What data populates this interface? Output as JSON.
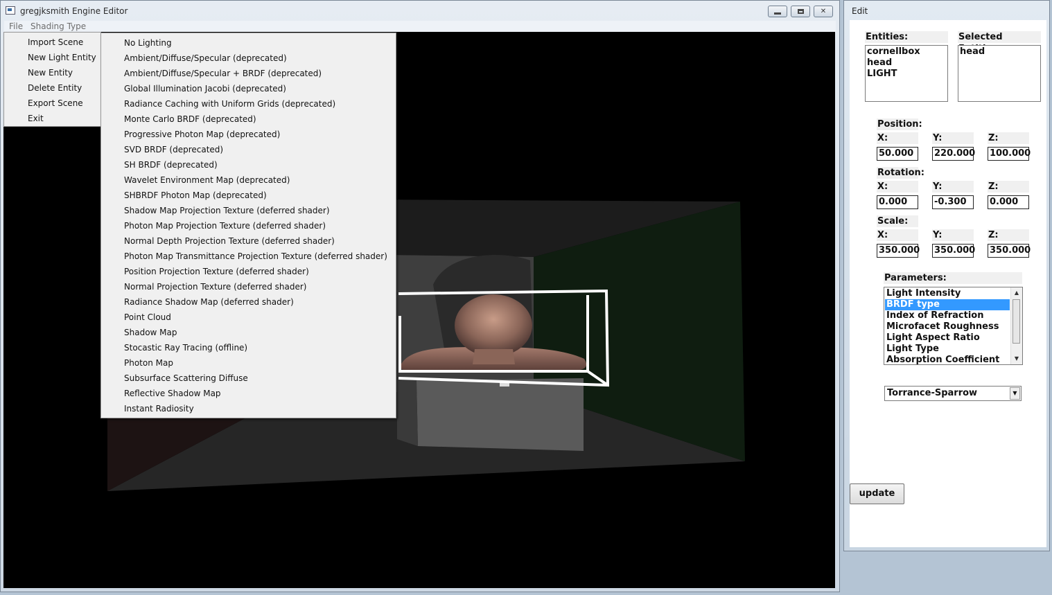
{
  "main_window": {
    "title": "gregjksmith Engine Editor",
    "menubar": [
      "File",
      "Shading Type"
    ]
  },
  "file_menu": [
    "Import Scene",
    "New Light Entity",
    "New Entity",
    "Delete Entity",
    "Export Scene",
    "Exit"
  ],
  "shading_menu": [
    "No Lighting",
    "Ambient/Diffuse/Specular (deprecated)",
    "Ambient/Diffuse/Specular + BRDF (deprecated)",
    "Global Illumination Jacobi (deprecated)",
    "Radiance Caching with Uniform Grids (deprecated)",
    "Monte Carlo BRDF (deprecated)",
    "Progressive Photon Map (deprecated)",
    "SVD BRDF (deprecated)",
    "SH BRDF (deprecated)",
    "Wavelet Environment Map (deprecated)",
    "SHBRDF Photon Map (deprecated)",
    "Shadow Map Projection Texture (deferred shader)",
    "Photon Map Projection Texture (deferred shader)",
    "Normal Depth Projection Texture (deferred shader)",
    "Photon Map Transmittance Projection Texture (deferred shader)",
    "Position Projection Texture (deferred shader)",
    "Normal Projection Texture (deferred shader)",
    "Radiance Shadow Map (deferred shader)",
    "Point Cloud",
    "Shadow Map",
    "Stocastic Ray Tracing (offline)",
    "Photon Map",
    "Subsurface Scattering Diffuse",
    "Reflective Shadow Map",
    "Instant Radiosity"
  ],
  "edit_window": {
    "title": "Edit",
    "entities_label": "Entities:",
    "entities": [
      "cornellbox",
      "head",
      "LIGHT"
    ],
    "selected_label": "Selected Entities:",
    "selected": [
      "head"
    ],
    "position": {
      "label": "Position:",
      "x_label": "X:",
      "y_label": "Y:",
      "z_label": "Z:",
      "x": "50.000",
      "y": "220.000",
      "z": "100.000"
    },
    "rotation": {
      "label": "Rotation:",
      "x_label": "X:",
      "y_label": "Y:",
      "z_label": "Z:",
      "x": "0.000",
      "y": "-0.300",
      "z": "0.000"
    },
    "scale": {
      "label": "Scale:",
      "x_label": "X:",
      "y_label": "Y:",
      "z_label": "Z:",
      "x": "350.000",
      "y": "350.000",
      "z": "350.000"
    },
    "parameters_label": "Parameters:",
    "parameters": [
      "Light Intensity",
      "BRDF type",
      "Index of Refraction",
      "Microfacet Roughness",
      "Light Aspect Ratio",
      "Light Type",
      "Absorption Coefficient"
    ],
    "selected_parameter": "BRDF type",
    "combo_value": "Torrance-Sparrow",
    "update_label": "update"
  },
  "colors": {
    "selection": "#3399ff",
    "viewport_bg": "#000000",
    "menu_bg": "#f0f0f0"
  }
}
